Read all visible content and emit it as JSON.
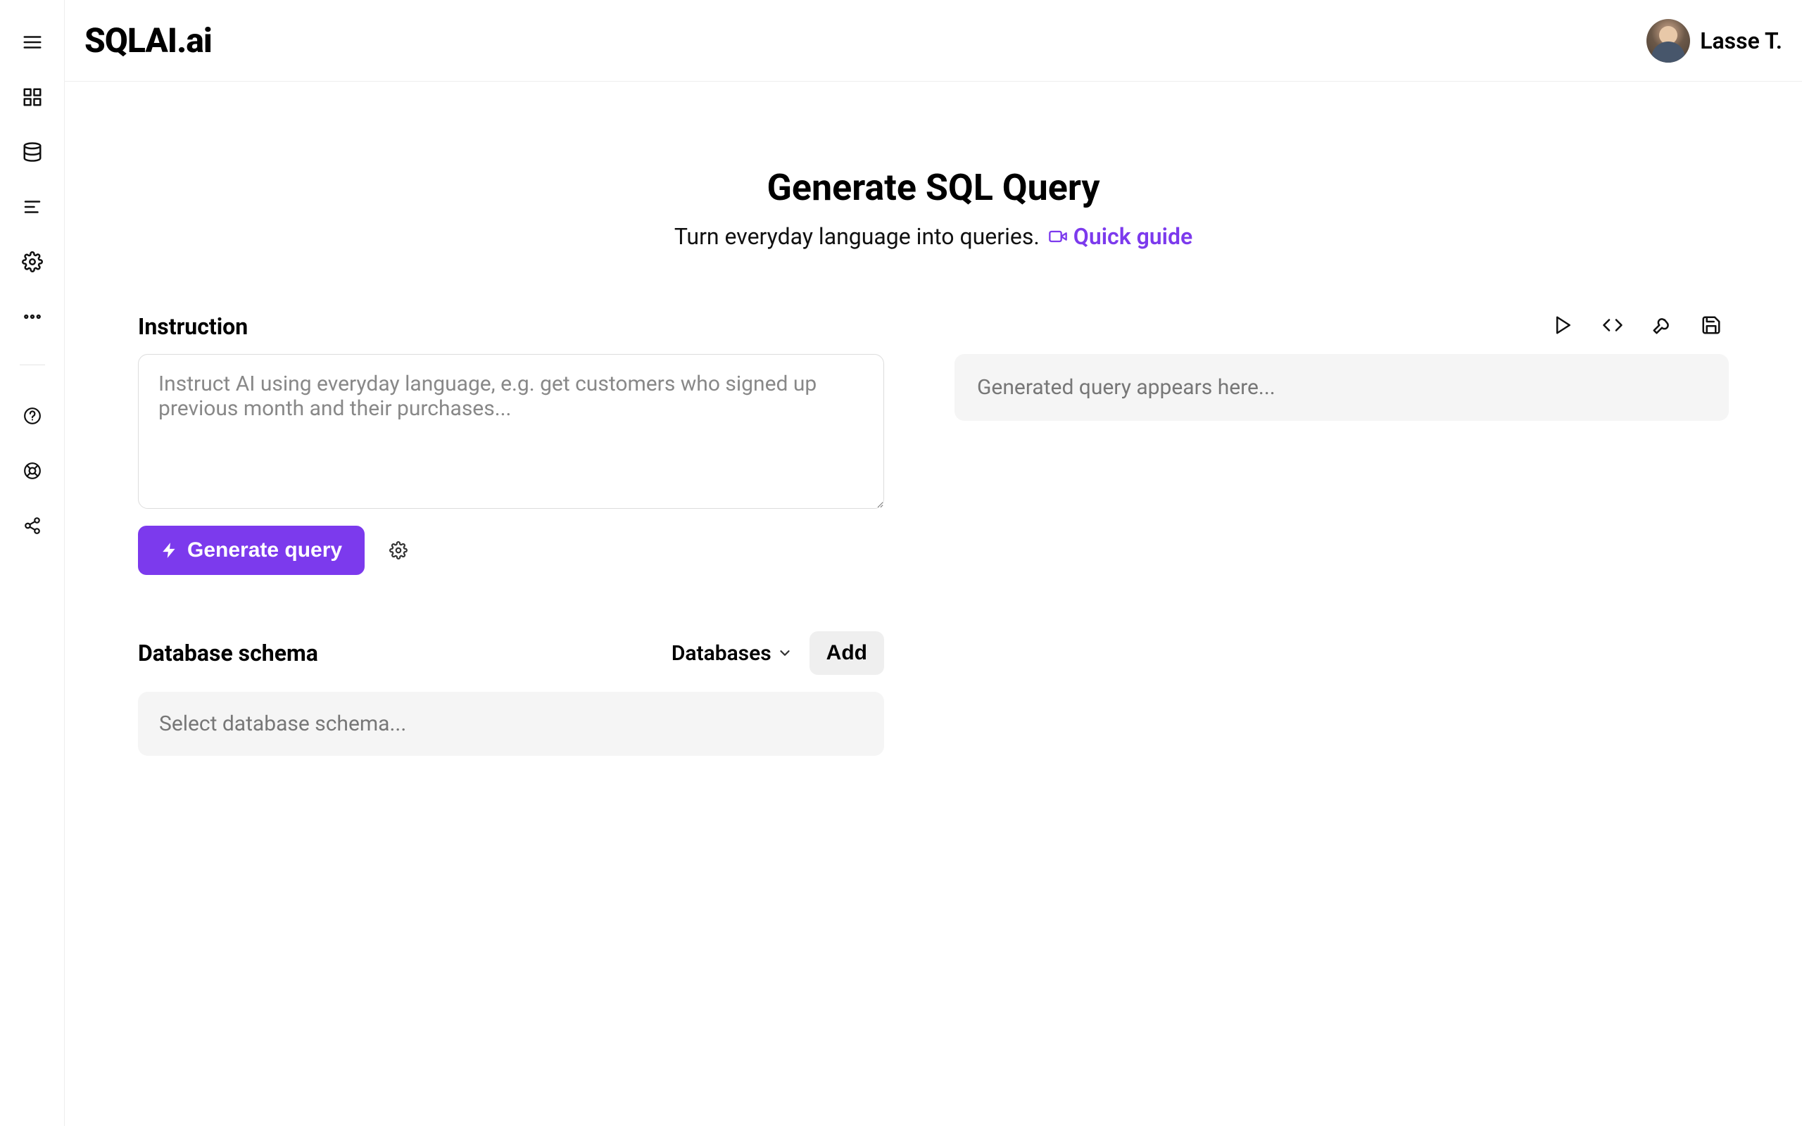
{
  "brand": "SQLAI.ai",
  "user": {
    "name": "Lasse T."
  },
  "page": {
    "title": "Generate SQL Query",
    "subtitle": "Turn everyday language into queries.",
    "quick_guide_label": "Quick guide"
  },
  "left": {
    "instruction_label": "Instruction",
    "instruction_placeholder": "Instruct AI using everyday language, e.g. get customers who signed up previous month and their purchases...",
    "generate_button": "Generate query",
    "schema_label": "Database schema",
    "databases_label": "Databases",
    "add_button": "Add",
    "schema_select_placeholder": "Select database schema..."
  },
  "right": {
    "output_placeholder": "Generated query appears here..."
  },
  "colors": {
    "accent": "#7c3aed"
  }
}
